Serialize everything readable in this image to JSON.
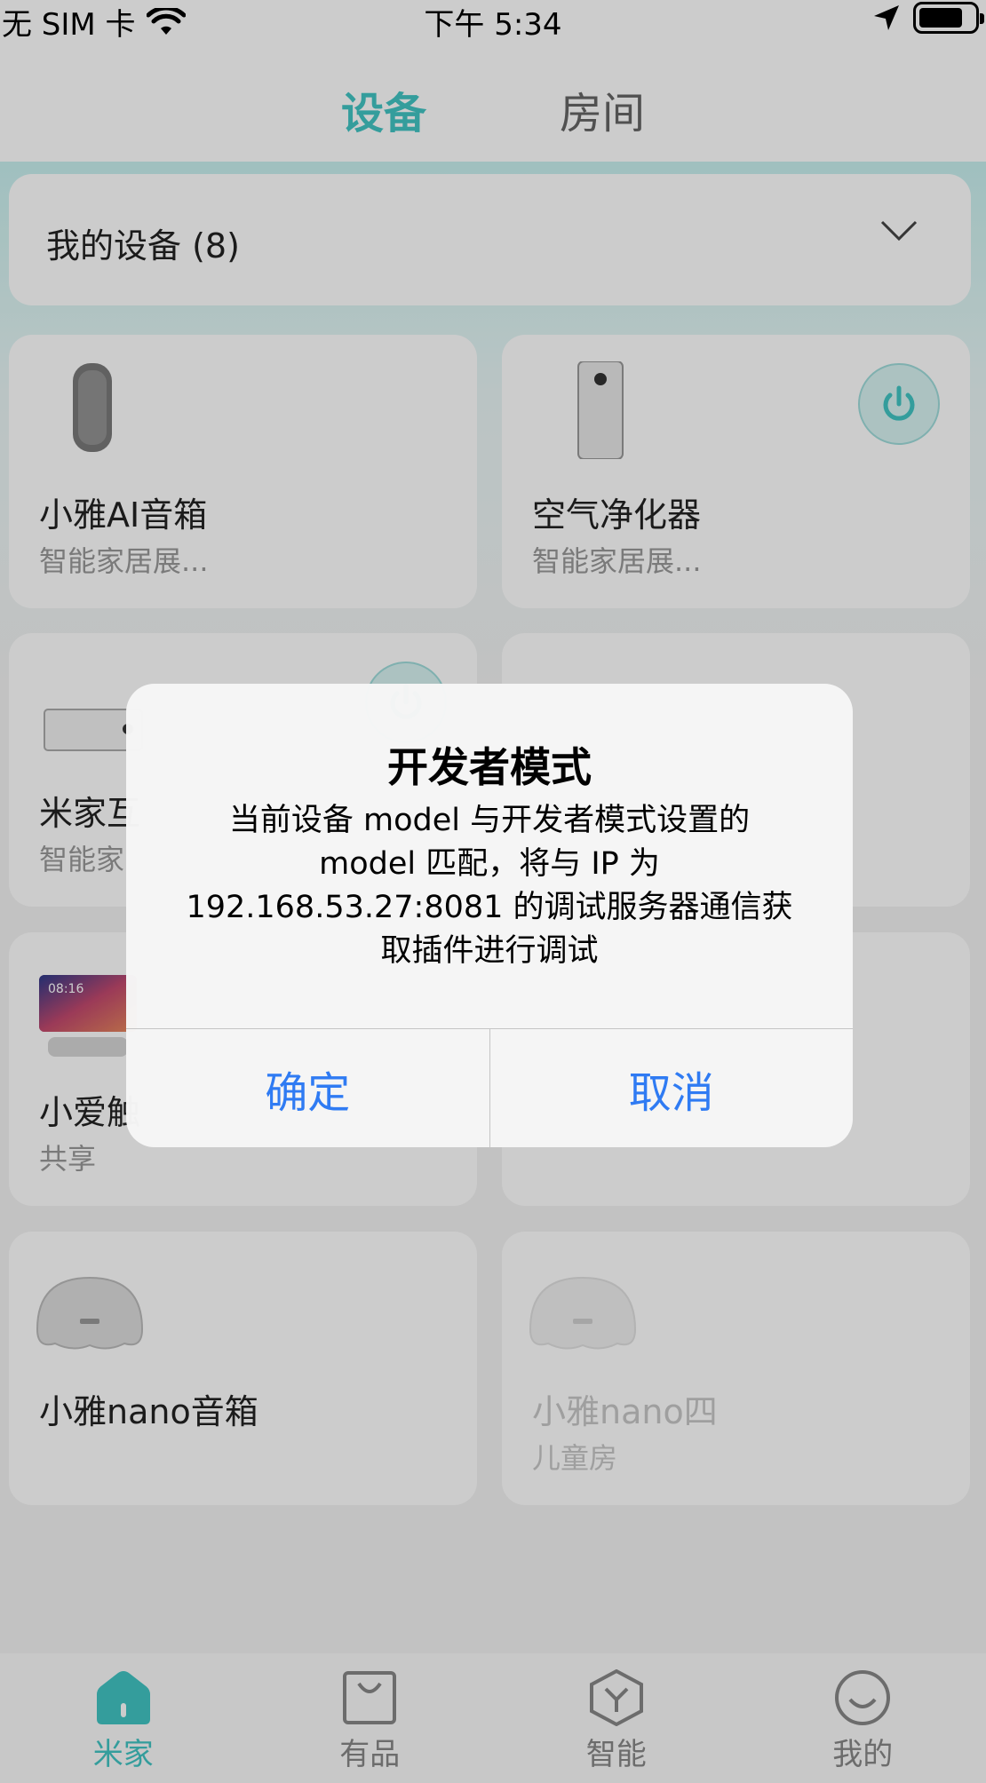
{
  "status_bar": {
    "carrier": "无 SIM 卡",
    "time": "下午 5:34"
  },
  "top_tabs": [
    {
      "label": "设备"
    },
    {
      "label": "房间"
    }
  ],
  "filter": {
    "label": "我的设备 (8)"
  },
  "devices": [
    {
      "name": "小雅AI音箱",
      "sub": "智能家居展..."
    },
    {
      "name": "空气净化器",
      "sub": "智能家居展..."
    },
    {
      "name": "米家互",
      "sub": "智能家"
    },
    {
      "name": "",
      "sub": ""
    },
    {
      "name": "小爱触",
      "sub": "共享",
      "screen_time": "08:16"
    },
    {
      "name": "",
      "sub": ""
    },
    {
      "name": "小雅nano音箱",
      "sub": ""
    },
    {
      "name": "小雅nano四",
      "sub": "儿童房"
    }
  ],
  "bottom_nav": [
    {
      "label": "米家",
      "icon": "home-icon"
    },
    {
      "label": "有品",
      "icon": "shopping-bag-icon"
    },
    {
      "label": "智能",
      "icon": "hexagon-y-icon"
    },
    {
      "label": "我的",
      "icon": "smiley-icon"
    }
  ],
  "dialog": {
    "title": "开发者模式",
    "message": "当前设备 model 与开发者模式设置的 model 匹配，将与 IP 为 192.168.53.27:8081 的调试服务器通信获取插件进行调试",
    "confirm": "确定",
    "cancel": "取消"
  },
  "colors": {
    "accent": "#41c5c4",
    "dialog_button": "#2f7bf3"
  }
}
